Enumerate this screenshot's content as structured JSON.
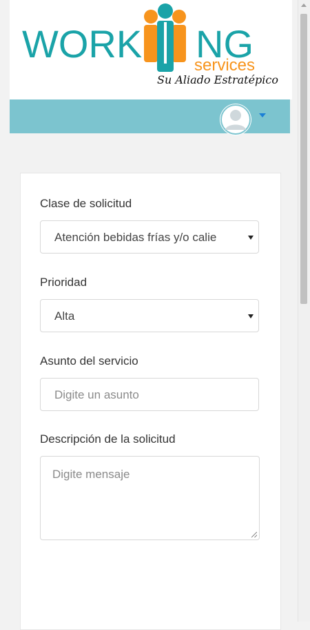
{
  "brand": {
    "work_text": "WORK",
    "ng_text": "NG",
    "services_text": "services",
    "tagline": "Su Aliado Estratépico",
    "colors": {
      "teal": "#1aa3a8",
      "orange": "#f7941d",
      "navbar": "#7cc4cf"
    }
  },
  "navbar": {
    "user_icon": "user-avatar-icon",
    "caret_icon": "caret-down-icon"
  },
  "form": {
    "clase": {
      "label": "Clase de solicitud",
      "value": "Atención bebidas frías y/o calie"
    },
    "prioridad": {
      "label": "Prioridad",
      "value": "Alta"
    },
    "asunto": {
      "label": "Asunto del servicio",
      "placeholder": "Digite un asunto"
    },
    "descripcion": {
      "label": "Descripción de la solicitud",
      "placeholder": "Digite mensaje"
    }
  }
}
